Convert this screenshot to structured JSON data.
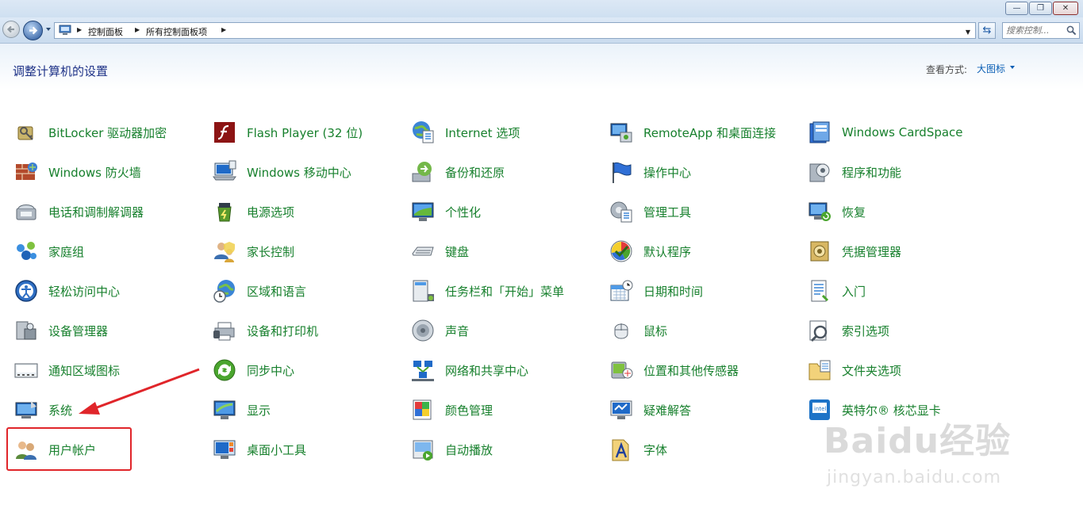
{
  "window": {
    "controls": {
      "minimize": "—",
      "maximize": "❐",
      "close": "✕"
    }
  },
  "address": {
    "breadcrumbs": [
      "控制面板",
      "所有控制面板项"
    ],
    "search_placeholder": "搜索控制..."
  },
  "header": {
    "title": "调整计算机的设置",
    "view_by_label": "查看方式:",
    "view_by_value": "大图标"
  },
  "items": [
    {
      "label": "BitLocker 驱动器加密",
      "icon": "bitlocker-icon"
    },
    {
      "label": "Windows 防火墙",
      "icon": "firewall-icon"
    },
    {
      "label": "电话和调制解调器",
      "icon": "phone-modem-icon"
    },
    {
      "label": "家庭组",
      "icon": "homegroup-icon"
    },
    {
      "label": "轻松访问中心",
      "icon": "ease-of-access-icon"
    },
    {
      "label": "设备管理器",
      "icon": "device-manager-icon"
    },
    {
      "label": "通知区域图标",
      "icon": "notification-icons-icon"
    },
    {
      "label": "系统",
      "icon": "system-icon"
    },
    {
      "label": "用户帐户",
      "icon": "user-accounts-icon"
    },
    {
      "label": "Flash Player (32 位)",
      "icon": "flash-player-icon"
    },
    {
      "label": "Windows 移动中心",
      "icon": "mobility-center-icon"
    },
    {
      "label": "电源选项",
      "icon": "power-options-icon"
    },
    {
      "label": "家长控制",
      "icon": "parental-controls-icon"
    },
    {
      "label": "区域和语言",
      "icon": "region-language-icon"
    },
    {
      "label": "设备和打印机",
      "icon": "devices-printers-icon"
    },
    {
      "label": "同步中心",
      "icon": "sync-center-icon"
    },
    {
      "label": "显示",
      "icon": "display-icon"
    },
    {
      "label": "桌面小工具",
      "icon": "desktop-gadgets-icon"
    },
    {
      "label": "Internet 选项",
      "icon": "internet-options-icon"
    },
    {
      "label": "备份和还原",
      "icon": "backup-restore-icon"
    },
    {
      "label": "个性化",
      "icon": "personalization-icon"
    },
    {
      "label": "键盘",
      "icon": "keyboard-icon"
    },
    {
      "label": "任务栏和「开始」菜单",
      "icon": "taskbar-start-icon"
    },
    {
      "label": "声音",
      "icon": "sound-icon"
    },
    {
      "label": "网络和共享中心",
      "icon": "network-sharing-icon"
    },
    {
      "label": "颜色管理",
      "icon": "color-management-icon"
    },
    {
      "label": "自动播放",
      "icon": "autoplay-icon"
    },
    {
      "label": "RemoteApp 和桌面连接",
      "icon": "remoteapp-icon"
    },
    {
      "label": "操作中心",
      "icon": "action-center-icon"
    },
    {
      "label": "管理工具",
      "icon": "admin-tools-icon"
    },
    {
      "label": "默认程序",
      "icon": "default-programs-icon"
    },
    {
      "label": "日期和时间",
      "icon": "date-time-icon"
    },
    {
      "label": "鼠标",
      "icon": "mouse-icon"
    },
    {
      "label": "位置和其他传感器",
      "icon": "location-sensors-icon"
    },
    {
      "label": "疑难解答",
      "icon": "troubleshooting-icon"
    },
    {
      "label": "字体",
      "icon": "fonts-icon"
    },
    {
      "label": "Windows CardSpace",
      "icon": "cardspace-icon"
    },
    {
      "label": "程序和功能",
      "icon": "programs-features-icon"
    },
    {
      "label": "恢复",
      "icon": "recovery-icon"
    },
    {
      "label": "凭据管理器",
      "icon": "credential-manager-icon"
    },
    {
      "label": "入门",
      "icon": "getting-started-icon"
    },
    {
      "label": "索引选项",
      "icon": "indexing-options-icon"
    },
    {
      "label": "文件夹选项",
      "icon": "folder-options-icon"
    },
    {
      "label": "英特尔® 核芯显卡",
      "icon": "intel-graphics-icon"
    }
  ],
  "watermark": {
    "logo": "Baidu经验",
    "url": "jingyan.baidu.com"
  },
  "colors": {
    "item_link": "#17802d",
    "title": "#1e3287",
    "highlight": "#e0252a",
    "link": "#0b5fb5"
  }
}
